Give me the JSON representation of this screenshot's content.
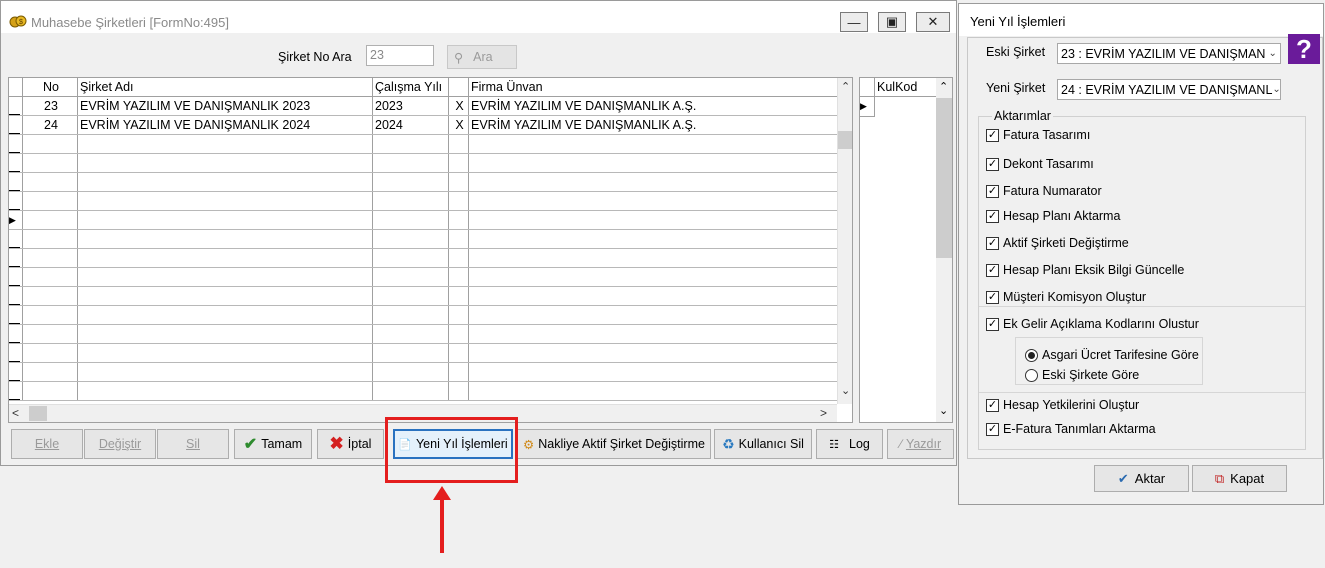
{
  "main_window": {
    "title": "Muhasebe Şirketleri [FormNo:495]",
    "search": {
      "label": "Şirket No Ara",
      "value": "23",
      "button": "Ara"
    },
    "grid": {
      "columns": [
        "No",
        "Şirket Adı",
        "Çalışma Yılı",
        "",
        "Firma Ünvan"
      ],
      "rows": [
        {
          "no": "23",
          "name": "EVRİM YAZILIM  VE DANIŞMANLIK 2023",
          "year": "2023",
          "flag": "X",
          "title": "EVRİM YAZILIM VE DANIŞMANLIK A.Ş."
        },
        {
          "no": "24",
          "name": "EVRİM YAZILIM VE DANIŞMANLIK  2024",
          "year": "2024",
          "flag": "X",
          "title": "EVRİM YAZILIM VE DANIŞMANLIK A.Ş."
        }
      ]
    },
    "side_grid": {
      "column": "KulKod"
    },
    "buttons": {
      "ekle": "Ekle",
      "degistir": "Değiştir",
      "sil": "Sil",
      "tamam": "Tamam",
      "iptal": "İptal",
      "yeni_yil": "Yeni Yıl İşlemleri",
      "nakliye": "Nakliye Aktif Şirket Değiştirme",
      "kullanici_sil": "Kullanıcı Sil",
      "log": "Log",
      "yazdir": "Yazdır"
    }
  },
  "dialog": {
    "title": "Yeni Yıl İşlemleri",
    "eski_label": "Eski Şirket",
    "eski_value": "23 : EVRİM YAZILIM  VE DANIŞMAN",
    "yeni_label": "Yeni Şirket",
    "yeni_value": "24 : EVRİM YAZILIM VE DANIŞMANL",
    "group_label": "Aktarımlar",
    "checks": [
      "Fatura Tasarımı",
      "Dekont Tasarımı",
      "Fatura Numarator",
      "Hesap Planı Aktarma",
      "Aktif Şirketi Değiştirme",
      "Hesap Planı Eksik Bilgi Güncelle",
      "Müşteri Komisyon Oluştur",
      "Ek Gelir Açıklama Kodlarını Olustur"
    ],
    "radios": [
      "Asgari Ücret Tarifesine Göre",
      "Eski Şirkete Göre"
    ],
    "checks2": [
      "Hesap Yetkilerini Oluştur",
      "E-Fatura Tanımları Aktarma"
    ],
    "aktar": "Aktar",
    "kapat": "Kapat"
  },
  "colors": {
    "highlight": "#e41e1e",
    "help_icon": "#6a1b9a"
  }
}
